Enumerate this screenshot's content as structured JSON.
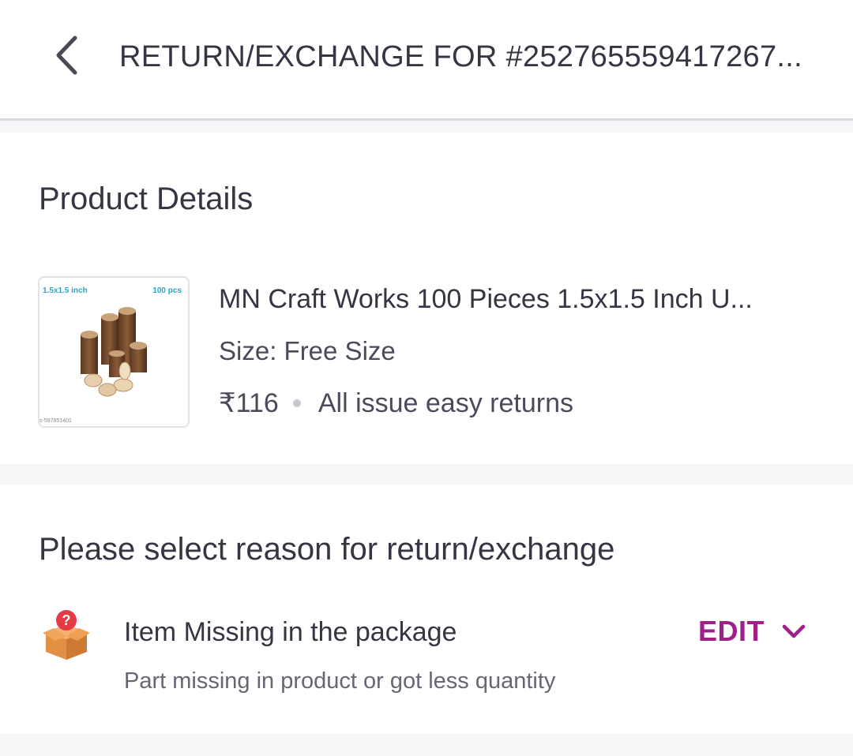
{
  "header": {
    "title": "RETURN/EXCHANGE FOR #252765559417267..."
  },
  "product_section": {
    "title": "Product Details",
    "thumbnail": {
      "size_label": "1.5x1.5 inch",
      "pcs_label": "100 pcs",
      "code_label": "s-597851401"
    },
    "name": "MN Craft Works 100 Pieces 1.5x1.5 Inch U...",
    "size": "Size: Free Size",
    "price": "₹116",
    "returns_note": "All issue easy returns"
  },
  "reason_section": {
    "title": "Please select reason for return/exchange",
    "icon": "missing-box-icon",
    "reason_title": "Item Missing in the package",
    "reason_subtitle": "Part missing in product or got less quantity",
    "edit_label": "EDIT"
  },
  "colors": {
    "accent": "#9f2089",
    "text_primary": "#353543",
    "background": "#f6f6f8"
  }
}
